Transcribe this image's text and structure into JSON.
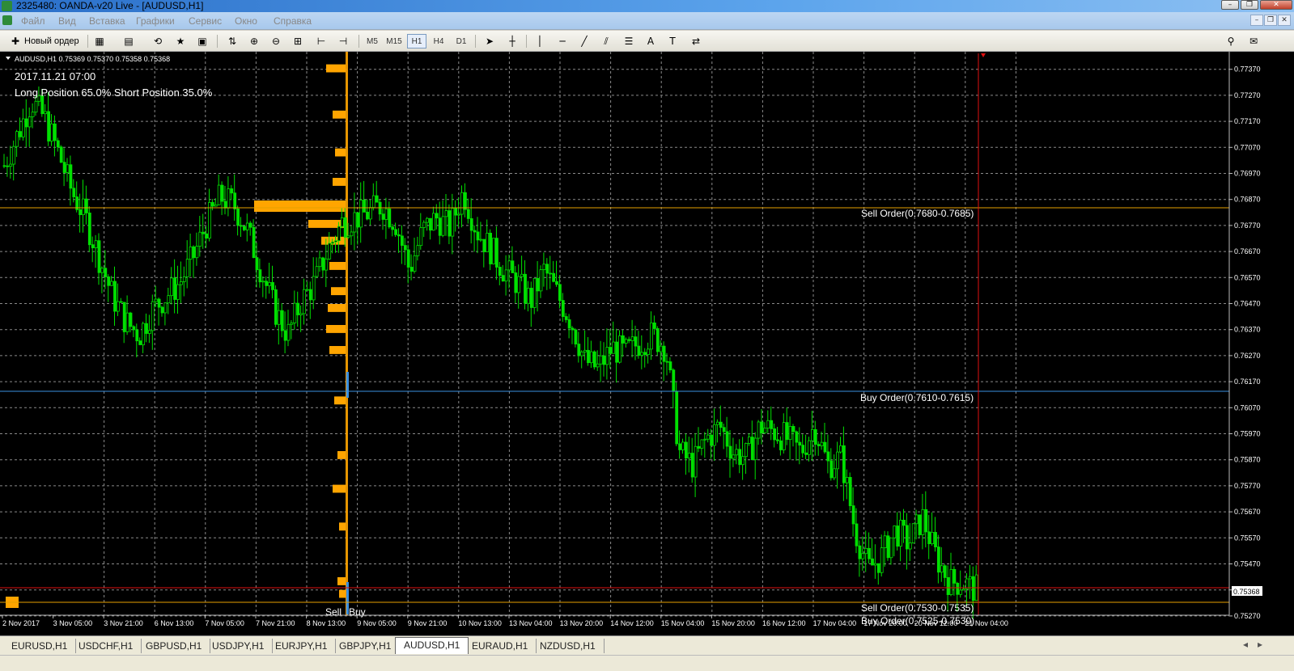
{
  "window": {
    "title": "2325480: OANDA-v20 Live - [AUDUSD,H1]",
    "buttons": [
      "–",
      "❐",
      "✕"
    ],
    "mdi_buttons": [
      "–",
      "❐",
      "✕"
    ]
  },
  "menu": [
    "Файл",
    "Вид",
    "Вставка",
    "Графики",
    "Сервис",
    "Окно",
    "Справка"
  ],
  "toolbar": {
    "new_order": "Новый ордер",
    "timeframes": [
      "M5",
      "M15",
      "H1",
      "H4",
      "D1"
    ],
    "active_timeframe": "H1"
  },
  "chart": {
    "header": "AUDUSD,H1  0.75369 0.75370 0.75358 0.75368",
    "info_date": "2017.11.21 07:00",
    "info_position": "Long Position 65.0% Short Position 35.0%",
    "current_price": "0.75368",
    "price_axis": [
      "0.77370",
      "0.77270",
      "0.77170",
      "0.77070",
      "0.76970",
      "0.76870",
      "0.76770",
      "0.76670",
      "0.76570",
      "0.76470",
      "0.76370",
      "0.76270",
      "0.76170",
      "0.76070",
      "0.75970",
      "0.75870",
      "0.75770",
      "0.75670",
      "0.75570",
      "0.75470",
      "0.75370",
      "0.75270"
    ],
    "time_axis": [
      "2 Nov 2017",
      "3 Nov 05:00",
      "3 Nov 21:00",
      "6 Nov 13:00",
      "7 Nov 05:00",
      "7 Nov 21:00",
      "8 Nov 13:00",
      "9 Nov 05:00",
      "9 Nov 21:00",
      "10 Nov 13:00",
      "13 Nov 04:00",
      "13 Nov 20:00",
      "14 Nov 12:00",
      "15 Nov 04:00",
      "15 Nov 20:00",
      "16 Nov 12:00",
      "17 Nov 04:00",
      "17 Nov 20:00",
      "20 Nov 12:00",
      "21 Nov 04:00"
    ],
    "order_labels": {
      "sell_upper": "Sell Order(0.7680-0.7685)",
      "buy_mid": "Buy Order(0.7610-0.7615)",
      "sell_lower": "Sell Order(0.7530-0.7535)",
      "buy_lower_partial": "Buy Order(0.7525-0.7530)"
    },
    "histogram_labels": {
      "sell": "Sell",
      "buy": "Buy"
    },
    "colors": {
      "candles": "#00e000",
      "grid": "#8a8a8a",
      "sell_bars": "#ffa500",
      "buy_line": "#3a8fe0",
      "sell_line": "#e6a100",
      "red_line": "#e01010"
    }
  },
  "tabs": [
    "EURUSD,H1",
    "USDCHF,H1",
    "GBPUSD,H1",
    "USDJPY,H1",
    "EURJPY,H1",
    "GBPJPY,H1",
    "AUDUSD,H1",
    "EURAUD,H1",
    "NZDUSD,H1"
  ],
  "active_tab": "AUDUSD,H1",
  "chart_data": {
    "type": "candlestick",
    "symbol": "AUDUSD",
    "timeframe": "H1",
    "ylim": [
      0.7522,
      0.7739
    ],
    "close_trend": [
      [
        0.77,
        0.7712,
        0.7725,
        0.7718,
        0.7705,
        0.769,
        0.768,
        0.7665,
        0.765,
        0.764,
        0.7635,
        0.7645,
        0.765
      ],
      [
        0.7655,
        0.7665,
        0.7678,
        0.7688,
        0.7685,
        0.7675,
        0.766,
        0.7645,
        0.7635,
        0.7648,
        0.7655,
        0.7668,
        0.7678,
        0.768,
        0.7682
      ],
      [
        0.7685,
        0.7678,
        0.766,
        0.7675,
        0.768,
        0.7676,
        0.769,
        0.7675,
        0.7668,
        0.766,
        0.7655,
        0.7648,
        0.766
      ],
      [
        0.765,
        0.764,
        0.7625,
        0.7622,
        0.763,
        0.7628,
        0.7632,
        0.7635,
        0.763
      ],
      [
        0.759,
        0.7585,
        0.7595,
        0.76,
        0.759,
        0.7588,
        0.76,
        0.7598,
        0.7595,
        0.759,
        0.76,
        0.7585,
        0.7588
      ],
      [
        0.756,
        0.7545,
        0.755,
        0.756,
        0.7555,
        0.7565,
        0.755,
        0.754,
        0.754,
        0.7537
      ]
    ]
  }
}
